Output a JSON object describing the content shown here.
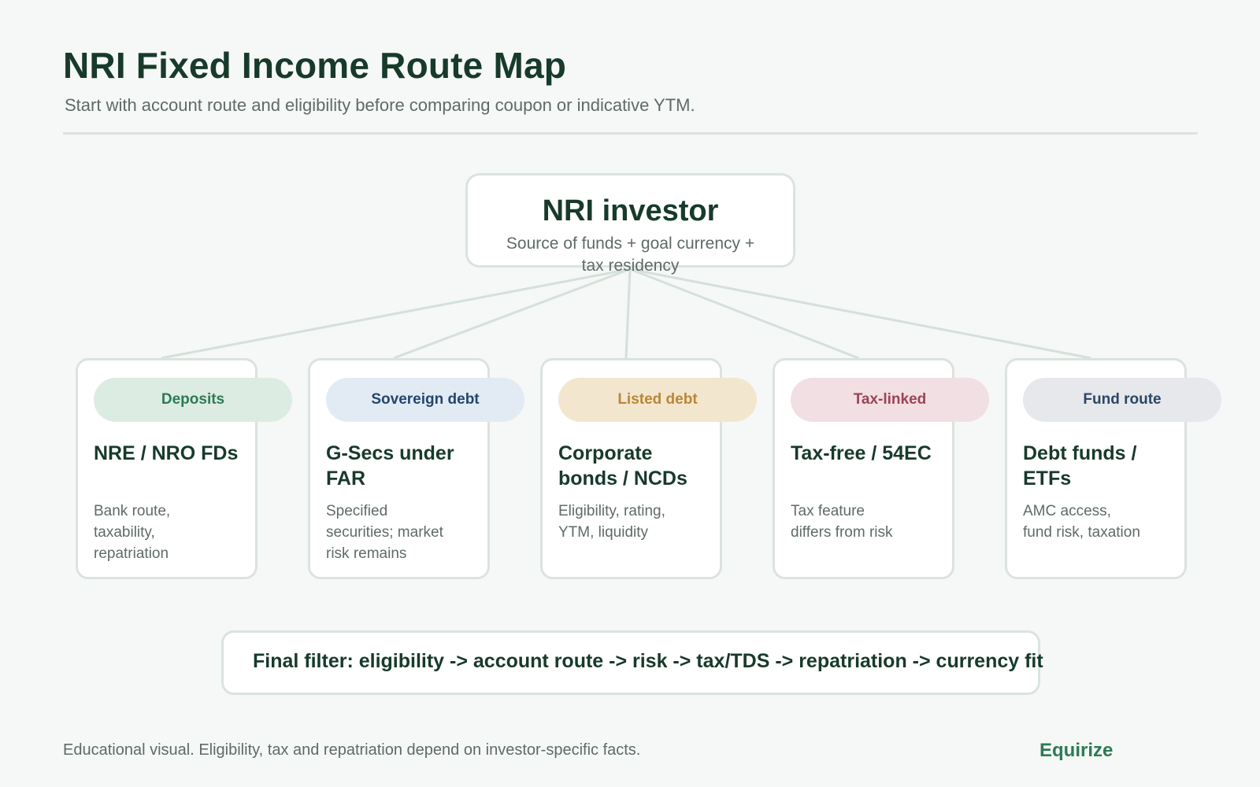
{
  "header": {
    "title": "NRI Fixed Income Route Map",
    "subtitle": "Start with account route and eligibility before comparing coupon or indicative YTM."
  },
  "root": {
    "title": "NRI investor",
    "subtitle": "Source of funds + goal currency + tax residency"
  },
  "routes": [
    {
      "tag": "Deposits",
      "title": "NRE / NRO FDs",
      "desc": "Bank route, taxability, repatriation",
      "tag_bg": "#dcece3",
      "tag_color": "#2d7a55"
    },
    {
      "tag": "Sovereign debt",
      "title": "G-Secs under FAR",
      "desc": "Specified securities; market risk remains",
      "tag_bg": "#e2ebf4",
      "tag_color": "#23466e"
    },
    {
      "tag": "Listed debt",
      "title": "Corporate bonds / NCDs",
      "desc": "Eligibility, rating, YTM, liquidity",
      "tag_bg": "#f3e6cf",
      "tag_color": "#b88734"
    },
    {
      "tag": "Tax-linked",
      "title": "Tax-free / 54EC",
      "desc": "Tax feature differs from risk",
      "tag_bg": "#f2dfe3",
      "tag_color": "#9c4357"
    },
    {
      "tag": "Fund route",
      "title": "Debt funds / ETFs",
      "desc": "AMC access, fund risk, taxation",
      "tag_bg": "#e6e8ec",
      "tag_color": "#2c4666"
    }
  ],
  "final_filter": "Final filter: eligibility -> account route -> risk -> tax/TDS -> repatriation -> currency fit",
  "footer": {
    "note": "Educational visual. Eligibility, tax and repatriation depend on investor-specific facts.",
    "brand": "Equirize"
  },
  "colors": {
    "title": "#173a2b",
    "muted_text": "#5f6b66",
    "brand": "#2d7a55",
    "border": "#dbe3de",
    "connector": "#d5e0da"
  }
}
